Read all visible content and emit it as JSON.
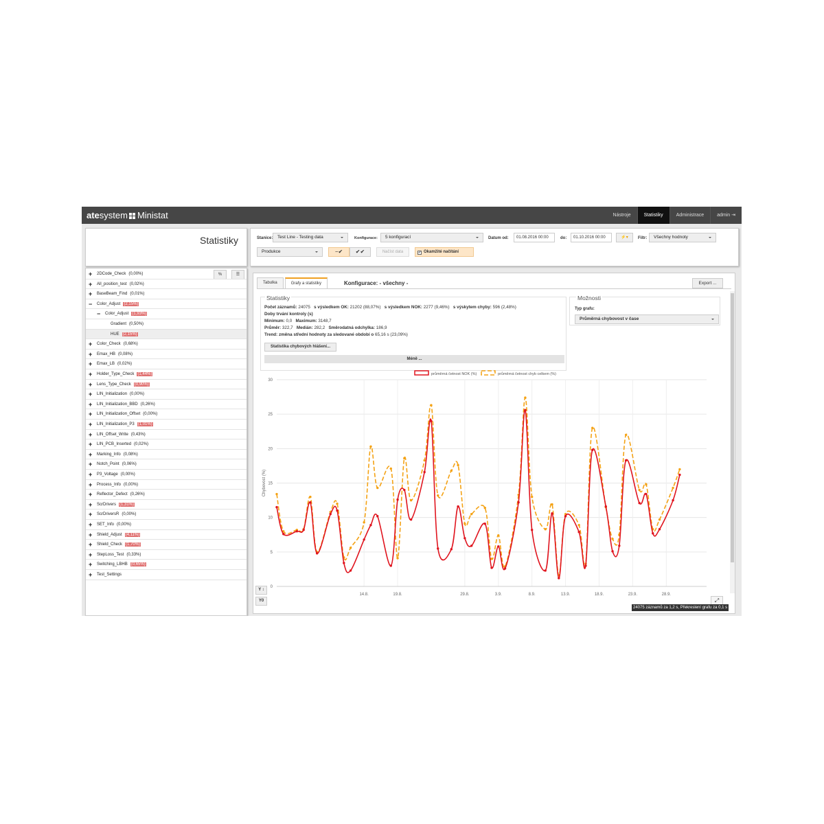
{
  "app": {
    "brand_bold": "ate",
    "brand_light": "system",
    "product": "Ministat",
    "nav": [
      {
        "label": "Nástroje",
        "active": false
      },
      {
        "label": "Statistiky",
        "active": true
      },
      {
        "label": "Administrace",
        "active": false
      },
      {
        "label": "admin",
        "active": false
      }
    ],
    "page_title": "Statistiky"
  },
  "toolbar": {
    "stanice_label": "Stanice:",
    "stanice_value": "Test Line - Testing data",
    "konfigurace_label": "Konfigurace:",
    "konfigurace_value": "5 konfigurací",
    "datum_od_label": "Datum od:",
    "datum_od_value": "01.08.2016 00:00",
    "do_label": "do:",
    "do_value": "01.10.2016 00:00",
    "filtr_label": "Filtr:",
    "filtr_value": "Všechny hodnoty",
    "produkce_value": "Produkce",
    "nacist_label": "Načíst data",
    "okamzite_label": "Okamžité načítání",
    "percent_label": "%"
  },
  "tree": [
    {
      "name": "2DCode_Check",
      "pct": "(0,00%)",
      "level": 0,
      "sign": "+",
      "hi": false
    },
    {
      "name": "All_position_test",
      "pct": "(0,02%)",
      "level": 0,
      "sign": "+",
      "hi": false
    },
    {
      "name": "BaseBeam_Find",
      "pct": "(0,01%)",
      "level": 0,
      "sign": "+",
      "hi": false
    },
    {
      "name": "Color_Adjust",
      "pct": "(2,15%)",
      "level": 0,
      "sign": "−",
      "hi": true
    },
    {
      "name": "Color_Adjust",
      "pct": "(1,93%)",
      "level": 1,
      "sign": "−",
      "hi": true
    },
    {
      "name": "Gradient",
      "pct": "(0,50%)",
      "level": 2,
      "sign": "",
      "hi": false
    },
    {
      "name": "HUE",
      "pct": "(2,15%)",
      "level": 2,
      "sign": "",
      "hi": true,
      "sel": true
    },
    {
      "name": "Color_Check",
      "pct": "(0,68%)",
      "level": 0,
      "sign": "+",
      "hi": false
    },
    {
      "name": "Emax_HB",
      "pct": "(0,08%)",
      "level": 0,
      "sign": "+",
      "hi": false
    },
    {
      "name": "Emax_LB",
      "pct": "(0,02%)",
      "level": 0,
      "sign": "+",
      "hi": false
    },
    {
      "name": "Holder_Type_Check",
      "pct": "(1,44%)",
      "level": 0,
      "sign": "+",
      "hi": true
    },
    {
      "name": "Lens_Type_Check",
      "pct": "(0,90%)",
      "level": 0,
      "sign": "+",
      "hi": true
    },
    {
      "name": "LIN_Initialization",
      "pct": "(0,00%)",
      "level": 0,
      "sign": "+",
      "hi": false
    },
    {
      "name": "LIN_Initialization_BBD",
      "pct": "(0,26%)",
      "level": 0,
      "sign": "+",
      "hi": false
    },
    {
      "name": "LIN_Initialization_Offset",
      "pct": "(0,00%)",
      "level": 0,
      "sign": "+",
      "hi": false
    },
    {
      "name": "LIN_Initialization_P3",
      "pct": "(1,01%)",
      "level": 0,
      "sign": "+",
      "hi": true
    },
    {
      "name": "LIN_Offset_Write",
      "pct": "(0,43%)",
      "level": 0,
      "sign": "+",
      "hi": false
    },
    {
      "name": "LIN_PCB_Inserted",
      "pct": "(0,02%)",
      "level": 0,
      "sign": "+",
      "hi": false
    },
    {
      "name": "Marking_Info",
      "pct": "(0,08%)",
      "level": 0,
      "sign": "+",
      "hi": false
    },
    {
      "name": "Notch_Point",
      "pct": "(0,06%)",
      "level": 0,
      "sign": "+",
      "hi": false
    },
    {
      "name": "P3_Voltage",
      "pct": "(0,00%)",
      "level": 0,
      "sign": "+",
      "hi": false
    },
    {
      "name": "Process_Info",
      "pct": "(0,00%)",
      "level": 0,
      "sign": "+",
      "hi": false
    },
    {
      "name": "Reflector_Defect",
      "pct": "(0,26%)",
      "level": 0,
      "sign": "+",
      "hi": false
    },
    {
      "name": "ScrDrivers",
      "pct": "(1,31%)",
      "level": 0,
      "sign": "+",
      "hi": true
    },
    {
      "name": "ScrDriversR",
      "pct": "(0,00%)",
      "level": 0,
      "sign": "+",
      "hi": false
    },
    {
      "name": "SET_Info",
      "pct": "(0,00%)",
      "level": 0,
      "sign": "+",
      "hi": false
    },
    {
      "name": "Shield_Adjust",
      "pct": "(4,11%)",
      "level": 0,
      "sign": "+",
      "hi": true
    },
    {
      "name": "Shield_Check",
      "pct": "(1,70%)",
      "level": 0,
      "sign": "+",
      "hi": true
    },
    {
      "name": "StepLoss_Test",
      "pct": "(0,33%)",
      "level": 0,
      "sign": "+",
      "hi": false
    },
    {
      "name": "Switching_LBHB",
      "pct": "(0,65%)",
      "level": 0,
      "sign": "+",
      "hi": true
    },
    {
      "name": "Test_Settings",
      "pct": "",
      "level": 0,
      "sign": "+",
      "hi": false
    }
  ],
  "main": {
    "tabs": [
      {
        "label": "Tabulka",
        "active": false
      },
      {
        "label": "Grafy a statistiky",
        "active": true
      }
    ],
    "config_title": "Konfigurace: - všechny -",
    "export_label": "Export ...",
    "stats": {
      "header": "Statistiky",
      "count_label": "Počet záznamů:",
      "count_value": "24075",
      "ok_label": "s výsledkem OK:",
      "ok_value": "21202 (88,07%)",
      "nok_label": "s výsledkem NOK:",
      "nok_value": "2277 (9,46%)",
      "err_label": "s výskytem chyby:",
      "err_value": "596 (2,48%)",
      "duration_label": "Doby trvání kontroly (s)",
      "min_label": "Minimum:",
      "min_value": "0,0",
      "max_label": "Maximum:",
      "max_value": "3148,7",
      "avg_label": "Průměr:",
      "avg_value": "322,7",
      "median_label": "Medián:",
      "median_value": "282,2",
      "std_label": "Směrodatná odchylka:",
      "std_value": "186,9",
      "trend_label": "Trend: změna střední hodnoty za sledované období o",
      "trend_value": "65,16 s (23,09%)",
      "err_stats_button": "Statistika chybových hlášení...",
      "less_button": "Méně ..."
    },
    "options": {
      "header": "Možnosti",
      "chart_type_label": "Typ grafu:",
      "chart_type_value": "Průměrná chybovost v čase"
    },
    "y_buttons": [
      "Y ↕",
      "Y0"
    ],
    "status": "24075 záznamů za 1,2 s, Překreslení grafu za 0,1 s"
  },
  "colors": {
    "nok": "#e0141e",
    "total": "#f4a214",
    "topbar": "#464646"
  },
  "chart_data": {
    "type": "line",
    "ylabel": "Chybovost (%)",
    "ylim": [
      0,
      30
    ],
    "yticks": [
      0,
      5,
      10,
      15,
      20,
      25,
      30
    ],
    "grid": true,
    "legend": "top-center",
    "xlim": [
      "2016-08-01",
      "2016-10-04"
    ],
    "xticks": [
      "14.8.",
      "19.8.",
      "29.8.",
      "3.9.",
      "8.9.",
      "13.9.",
      "18.9.",
      "23.9.",
      "28.9."
    ],
    "xtick_dates": [
      "2016-08-14",
      "2016-08-19",
      "2016-08-29",
      "2016-09-03",
      "2016-09-08",
      "2016-09-13",
      "2016-09-18",
      "2016-09-23",
      "2016-09-28"
    ],
    "x": [
      "2016-08-01",
      "2016-08-02",
      "2016-08-03",
      "2016-08-04",
      "2016-08-05",
      "2016-08-06",
      "2016-08-07",
      "2016-08-08",
      "2016-08-09",
      "2016-08-10",
      "2016-08-11",
      "2016-08-12",
      "2016-08-13",
      "2016-08-14",
      "2016-08-15",
      "2016-08-16",
      "2016-08-17",
      "2016-08-18",
      "2016-08-19",
      "2016-08-20",
      "2016-08-21",
      "2016-08-22",
      "2016-08-23",
      "2016-08-24",
      "2016-08-25",
      "2016-08-26",
      "2016-08-27",
      "2016-08-28",
      "2016-08-29",
      "2016-08-30",
      "2016-08-31",
      "2016-09-01",
      "2016-09-02",
      "2016-09-03",
      "2016-09-04",
      "2016-09-05",
      "2016-09-06",
      "2016-09-07",
      "2016-09-08",
      "2016-09-09",
      "2016-09-10",
      "2016-09-11",
      "2016-09-12",
      "2016-09-13",
      "2016-09-14",
      "2016-09-15",
      "2016-09-16",
      "2016-09-17",
      "2016-09-18",
      "2016-09-19",
      "2016-09-20",
      "2016-09-21",
      "2016-09-22",
      "2016-09-23",
      "2016-09-24",
      "2016-09-25",
      "2016-09-26",
      "2016-09-27",
      "2016-09-28",
      "2016-09-29",
      "2016-09-30"
    ],
    "series": [
      {
        "name": "průměrná četnost NOK (%)",
        "values": [
          11.5,
          7.6,
          8,
          8.2,
          12.2,
          4.8,
          10.5,
          11,
          3.4,
          2.3,
          6.8,
          8.9,
          10.2,
          3,
          12.6,
          14,
          9.7,
          16.6,
          24,
          5.5,
          5.4,
          11.6,
          7,
          5.9,
          9.1,
          2.7,
          5.8,
          2.6,
          12.2,
          25.6,
          8.2,
          2.3,
          10.6,
          1.2,
          10.2,
          7.9,
          3,
          19.8,
          11.6,
          5.1,
          5.9,
          18.3,
          12.1,
          13.4,
          7.7,
          8.3,
          12.5,
          16.2
        ]
      },
      {
        "name": "průměrná četnost chyb celkem (%)",
        "values": [
          13.4,
          8,
          8.2,
          8.3,
          13,
          5,
          10.8,
          12,
          4.2,
          5.6,
          9.3,
          20.3,
          14.3,
          17.1,
          4.1,
          18.6,
          12.5,
          18.3,
          26.3,
          13.2,
          16.8,
          17.6,
          9.1,
          10.5,
          11.4,
          4,
          7.4,
          2.9,
          13.3,
          27.4,
          13,
          8.3,
          11.9,
          1.6,
          10.5,
          8.9,
          3.3,
          23,
          11.5,
          6.9,
          7.5,
          22,
          14,
          14.8,
          8.3,
          9.7,
          14.3,
          17
        ]
      }
    ]
  }
}
